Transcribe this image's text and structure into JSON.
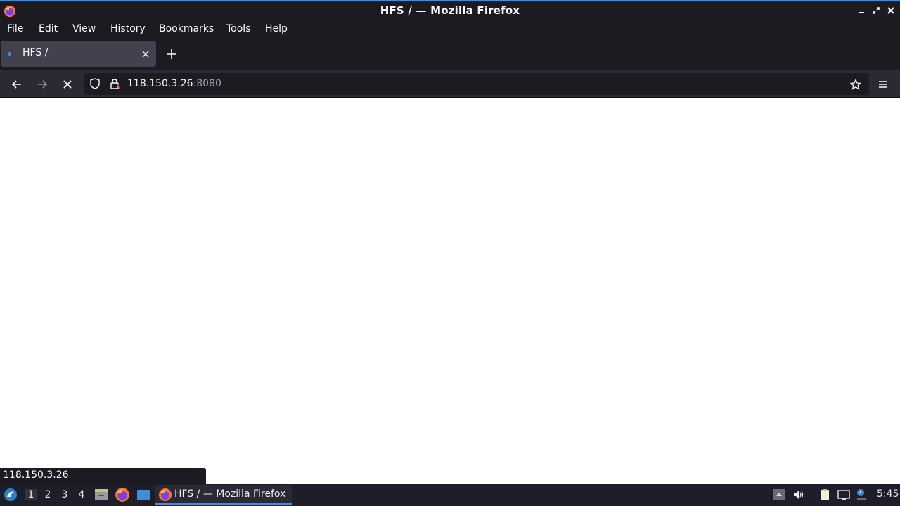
{
  "window": {
    "title": "HFS / — Mozilla Firefox"
  },
  "menu": {
    "file": "File",
    "edit": "Edit",
    "view": "View",
    "history": "History",
    "bookmarks": "Bookmarks",
    "tools": "Tools",
    "help": "Help"
  },
  "tabs": [
    {
      "label": "HFS /",
      "active": true,
      "loading": true
    }
  ],
  "navbar": {
    "url_host": "118.150.3.26",
    "url_port": ":8080"
  },
  "status": {
    "link_text": "118.150.3.26"
  },
  "taskbar": {
    "workspaces": [
      "1",
      "2",
      "3",
      "4"
    ],
    "active_workspace": "1",
    "task_label": "HFS / — Mozilla Firefox",
    "clock": "5:45"
  },
  "colors": {
    "accent": "#3d8fd9",
    "chrome_dark": "#1c1b22",
    "toolbar": "#2b2a33",
    "tab_active": "#42414d"
  },
  "icons": {
    "app": "firefox-icon",
    "back": "back-arrow-icon",
    "forward": "forward-arrow-icon",
    "stop": "stop-icon",
    "tracking": "shield-icon",
    "lock": "lock-icon",
    "bookmark": "star-icon",
    "menu": "hamburger-menu-icon"
  }
}
